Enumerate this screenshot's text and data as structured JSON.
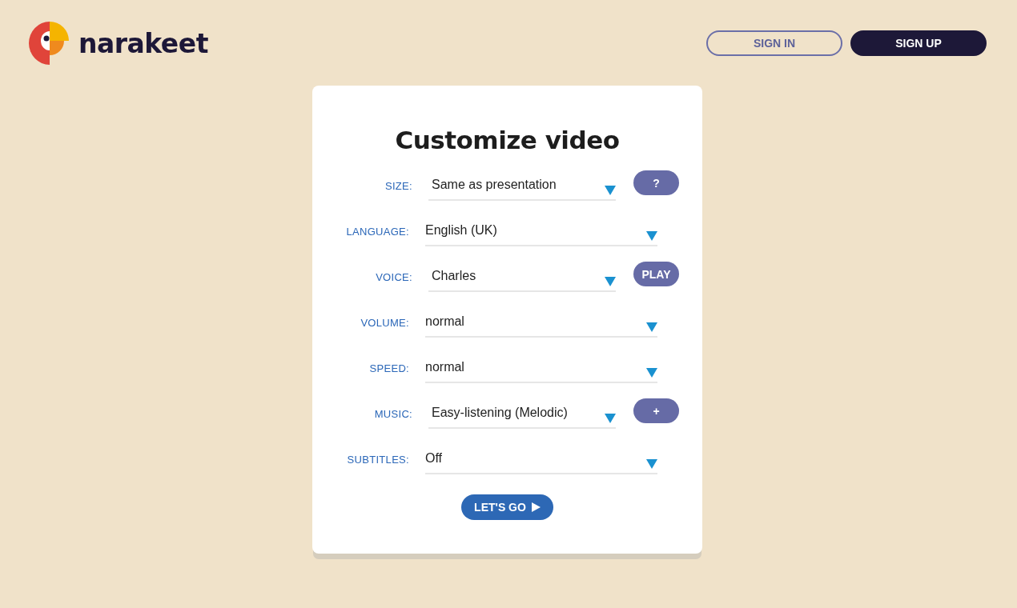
{
  "header": {
    "logo_text": "narakeet",
    "buttons": [
      {
        "label": "SIGN IN",
        "kind": "outline"
      },
      {
        "label": "SIGN UP",
        "kind": "filled"
      }
    ]
  },
  "card": {
    "title": "Customize video",
    "fields": [
      {
        "label": "SIZE:",
        "value": "Same as presentation",
        "button": "?"
      },
      {
        "label": "LANGUAGE:",
        "value": "English (UK)"
      },
      {
        "label": "VOICE:",
        "value": "Charles",
        "button": "PLAY"
      },
      {
        "label": "VOLUME:",
        "value": "normal"
      },
      {
        "label": "SPEED:",
        "value": "normal"
      },
      {
        "label": "MUSIC:",
        "value": "Easy-listening (Melodic)",
        "button": "+"
      },
      {
        "label": "SUBTITLES:",
        "value": "Off"
      }
    ],
    "submit": "LET'S GO"
  }
}
